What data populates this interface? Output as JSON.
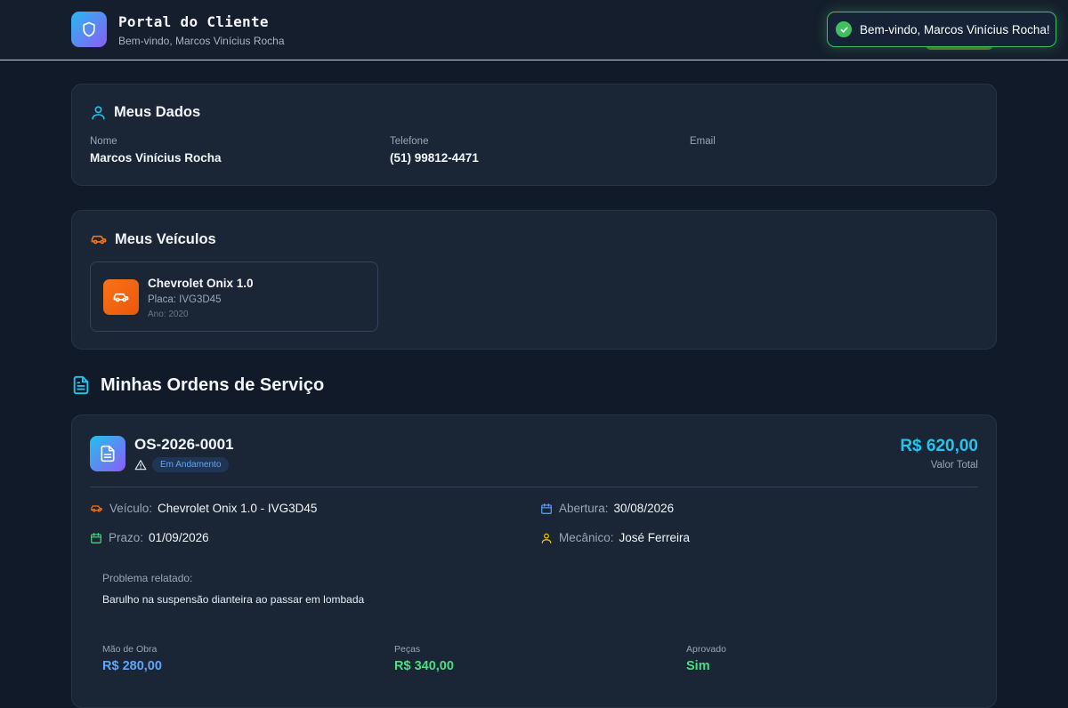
{
  "header": {
    "title": "Portal do Cliente",
    "subtitle": "Bem-vindo, Marcos Vinícius Rocha"
  },
  "toast": {
    "message": "Bem-vindo, Marcos Vinícius Rocha!"
  },
  "profile": {
    "title": "Meus Dados",
    "fields": [
      {
        "label": "Nome",
        "value": "Marcos Vinícius Rocha"
      },
      {
        "label": "Telefone",
        "value": "(51) 99812-4471"
      },
      {
        "label": "Email",
        "value": ""
      }
    ]
  },
  "vehicles": {
    "title": "Meus Veículos",
    "items": [
      {
        "name": "Chevrolet Onix 1.0",
        "plate": "Placa: IVG3D45",
        "year": "Ano: 2020"
      }
    ]
  },
  "orders": {
    "title": "Minhas Ordens de Serviço",
    "items": [
      {
        "number": "OS-2026-0001",
        "status": "Em Andamento",
        "total": "R$ 620,00",
        "total_label": "Valor Total",
        "vehicle_label": "Veículo:",
        "vehicle_value": "Chevrolet Onix 1.0 - IVG3D45",
        "opening_label": "Abertura:",
        "opening_value": "30/08/2026",
        "deadline_label": "Prazo:",
        "deadline_value": "01/09/2026",
        "mechanic_label": "Mecânico:",
        "mechanic_value": "José Ferreira",
        "problem_label": "Problema relatado:",
        "problem_text": "Barulho na suspensão dianteira ao passar em lombada",
        "labor_label": "Mão de Obra",
        "labor_value": "R$ 280,00",
        "parts_label": "Peças",
        "parts_value": "R$ 340,00",
        "approved_label": "Aprovado",
        "approved_value": "Sim"
      }
    ]
  },
  "colors": {
    "accent_cyan": "#22c5ee",
    "labor_blue": "#60a5fa",
    "parts_green": "#4ade80",
    "toast_green": "#3fbf5f",
    "vehicle_orange": "#f97316"
  }
}
